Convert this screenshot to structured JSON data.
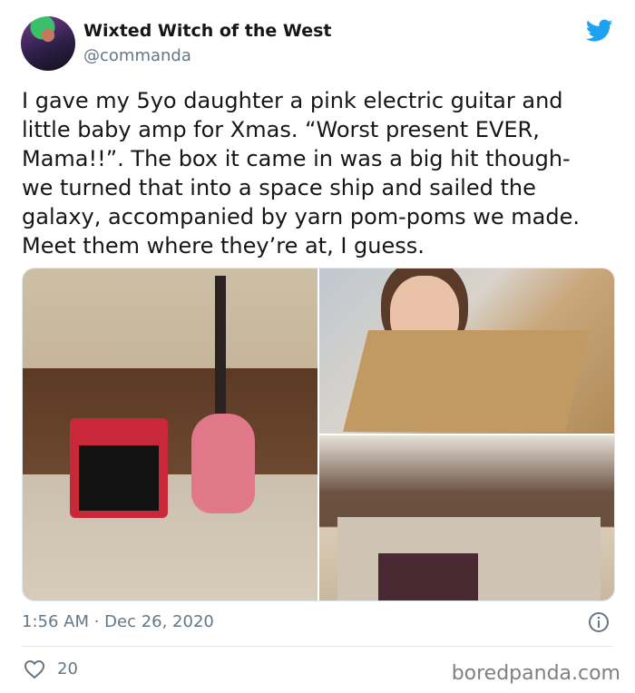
{
  "tweet": {
    "author_name": "Wixted Witch of the West",
    "handle": "@commanda",
    "text_lines": [
      "I gave my 5yo daughter a pink electric guitar and",
      "little baby amp for Xmas. “Worst present EVER,",
      "Mama!!”. The box it came in was a big hit though-",
      "we turned that into a space ship and sailed the",
      "galaxy, accompanied by yarn pom-poms we made.",
      "Meet them where they’re at, I guess."
    ],
    "timestamp": "1:56 AM · Dec 26, 2020",
    "likes": "20",
    "icons": {
      "brand": "twitter-bird-icon",
      "info": "info-icon",
      "like": "heart-icon"
    }
  },
  "watermark": "boredpanda.com",
  "colors": {
    "twitter_blue": "#1da1f2",
    "text": "#14171a",
    "secondary_text": "#657786",
    "divider": "#e1e8ed"
  }
}
